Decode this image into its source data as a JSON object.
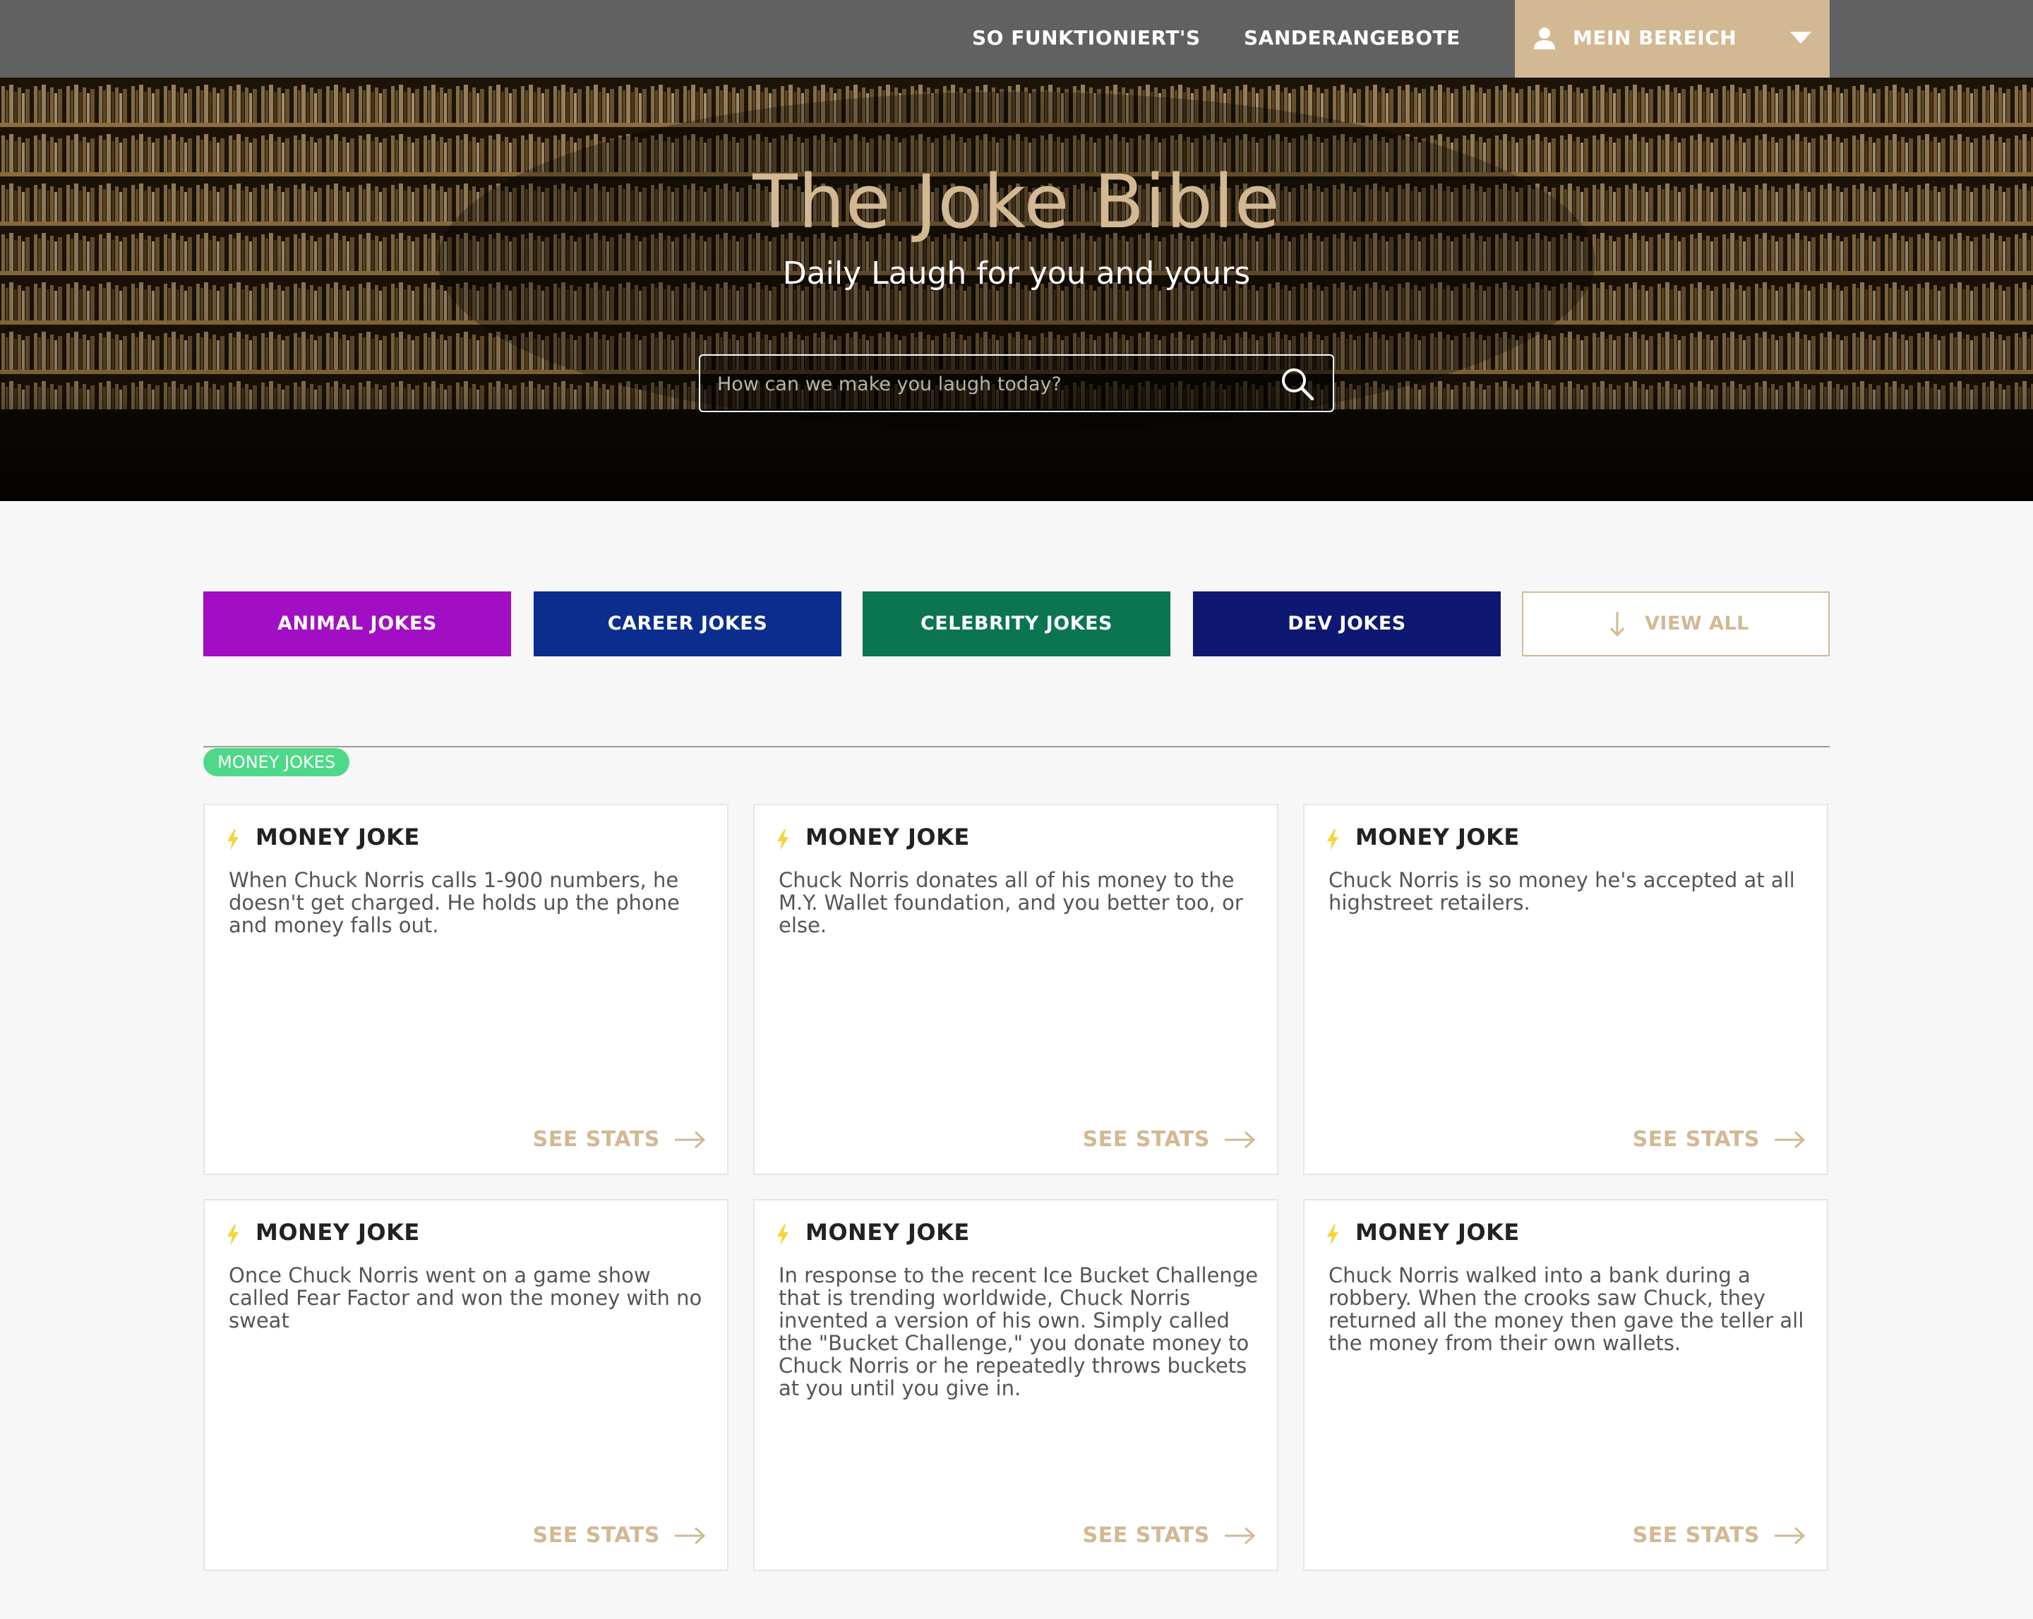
{
  "nav": {
    "how_it_works": "SO FUNKTIONIERT'S",
    "special_offers": "SANDERANGEBOTE",
    "account": "MEIN BEREICH"
  },
  "hero": {
    "title": "The Joke Bible",
    "subtitle": "Daily Laugh for you and yours",
    "search_placeholder": "How can we make you laugh today?"
  },
  "categories": [
    {
      "label": "ANIMAL JOKES",
      "color": "#a10ec4"
    },
    {
      "label": "CAREER JOKES",
      "color": "#0b2d8e"
    },
    {
      "label": "CELEBRITY JOKES",
      "color": "#0b7451"
    },
    {
      "label": "DEV JOKES",
      "color": "#0e1873"
    }
  ],
  "view_all_label": "VIEW ALL",
  "section": {
    "badge": "MONEY JOKES"
  },
  "cards": [
    {
      "title": "MONEY JOKE",
      "text": "When Chuck Norris calls 1-900 numbers, he doesn't get charged. He holds up the phone and money falls out.",
      "cta": "SEE STATS"
    },
    {
      "title": "MONEY JOKE",
      "text": "Chuck Norris donates all of his money to the M.Y. Wallet foundation, and you better too, or else.",
      "cta": "SEE STATS"
    },
    {
      "title": "MONEY JOKE",
      "text": "Chuck Norris is so money he's accepted at all highstreet retailers.",
      "cta": "SEE STATS"
    },
    {
      "title": "MONEY JOKE",
      "text": "Once Chuck Norris went on a game show called Fear Factor and won the money with no sweat",
      "cta": "SEE STATS"
    },
    {
      "title": "MONEY JOKE",
      "text": "In response to the recent Ice Bucket Challenge that is trending worldwide, Chuck Norris invented a version of his own. Simply called the \"Bucket Challenge,\" you donate money to Chuck Norris or he repeatedly throws buckets at you until you give in.",
      "cta": "SEE STATS"
    },
    {
      "title": "MONEY JOKE",
      "text": "Chuck Norris walked into a bank during a robbery. When the crooks saw Chuck, they returned all the money then gave the teller all the money from their own wallets.",
      "cta": "SEE STATS"
    }
  ],
  "colors": {
    "nav_bg": "#616161",
    "accent_gold": "#d2b993",
    "badge_green": "#4fd889",
    "bolt_yellow": "#f3d43a"
  },
  "icons": {
    "user": "user-icon",
    "caret": "caret-down-icon",
    "search": "search-icon",
    "view_all": "arrow-down-icon",
    "card_title": "bolt-icon",
    "see_stats": "arrow-right-icon"
  }
}
